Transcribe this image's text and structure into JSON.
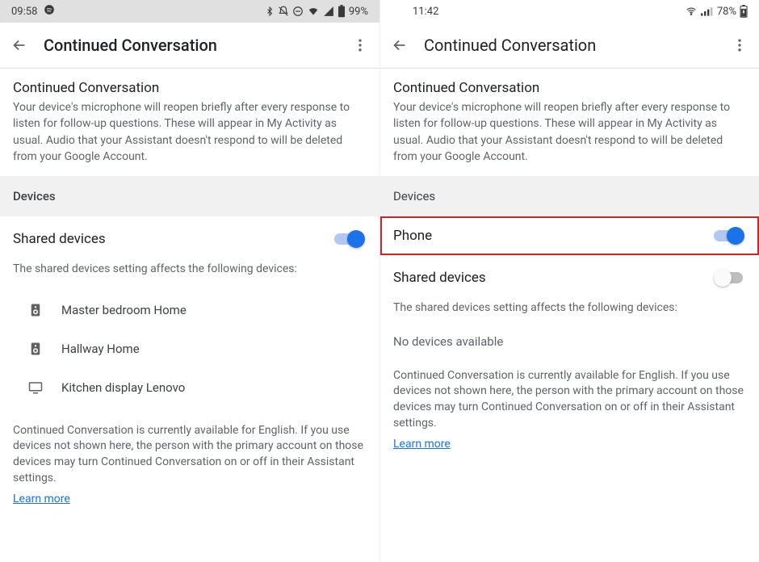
{
  "left": {
    "status": {
      "time": "09:58",
      "battery": "99%"
    },
    "appbar": {
      "title": "Continued Conversation"
    },
    "intro": {
      "title": "Continued Conversation",
      "body": "Your device's microphone will reopen briefly after every response to listen for follow-up questions. These will appear in My Activity as usual. Audio that your Assistant doesn't respond to will be deleted from your Google Account."
    },
    "devices_heading": "Devices",
    "shared_label": "Shared devices",
    "shared_sub": "The shared devices setting affects the following devices:",
    "devices": [
      {
        "name": "Master bedroom Home",
        "type": "speaker"
      },
      {
        "name": "Hallway Home",
        "type": "speaker"
      },
      {
        "name": "Kitchen display Lenovo",
        "type": "display"
      }
    ],
    "footer": "Continued Conversation is currently available for English. If you use devices not shown here, the person with the primary account on those devices may turn Continued Conversation on or off in their Assistant settings.",
    "learn_more": "Learn more"
  },
  "right": {
    "status": {
      "time": "11:42",
      "battery": "78%"
    },
    "appbar": {
      "title": "Continued Conversation"
    },
    "intro": {
      "title": "Continued Conversation",
      "body": "Your device's microphone will reopen briefly after every response to listen for follow-up questions. These will appear in My Activity as usual. Audio that your Assistant doesn't respond to will be deleted from your Google Account."
    },
    "devices_heading": "Devices",
    "phone_label": "Phone",
    "shared_label": "Shared devices",
    "shared_sub": "The shared devices setting affects the following devices:",
    "no_devices": "No devices available",
    "footer": "Continued Conversation is currently available for English. If you use devices not shown here, the person with the primary account on those devices may turn Continued Conversation on or off in their Assistant settings.",
    "learn_more": "Learn more"
  }
}
